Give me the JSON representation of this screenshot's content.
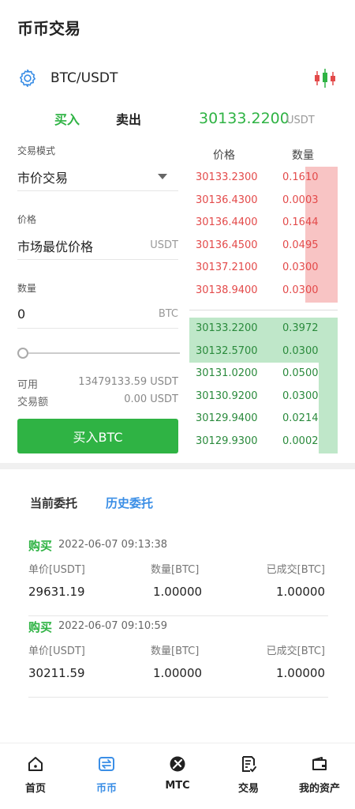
{
  "page": {
    "title": "币币交易"
  },
  "pair": {
    "symbol": "BTC/USDT"
  },
  "trade_tabs": {
    "buy": "买入",
    "sell": "卖出"
  },
  "ticker": {
    "price": "30133.2200",
    "unit": "USDT"
  },
  "form": {
    "mode_label": "交易模式",
    "mode_value": "市价交易",
    "price_label": "价格",
    "price_value": "市场最优价格",
    "price_unit": "USDT",
    "qty_label": "数量",
    "qty_value": "0",
    "qty_unit": "BTC",
    "slider_fraction": 0,
    "available_label": "可用",
    "available_value": "13479133.59 USDT",
    "amount_label": "交易额",
    "amount_value": "0.00 USDT",
    "buy_button": "买入BTC"
  },
  "book": {
    "price_header": "价格",
    "qty_header": "数量",
    "asks": [
      {
        "price": "30133.2300",
        "qty": "0.1610",
        "depth": 0.22
      },
      {
        "price": "30136.4300",
        "qty": "0.0003",
        "depth": 0.22
      },
      {
        "price": "30136.4400",
        "qty": "0.1644",
        "depth": 0.22
      },
      {
        "price": "30136.4500",
        "qty": "0.0495",
        "depth": 0.22
      },
      {
        "price": "30137.2100",
        "qty": "0.0300",
        "depth": 0.22
      },
      {
        "price": "30138.9400",
        "qty": "0.0300",
        "depth": 0.22
      }
    ],
    "bids": [
      {
        "price": "30133.2200",
        "qty": "0.3972",
        "depth": 1.0
      },
      {
        "price": "30132.5700",
        "qty": "0.0300",
        "depth": 1.0
      },
      {
        "price": "30131.0200",
        "qty": "0.0500",
        "depth": 0.13
      },
      {
        "price": "30130.9200",
        "qty": "0.0300",
        "depth": 0.13
      },
      {
        "price": "30129.9400",
        "qty": "0.0214",
        "depth": 0.13
      },
      {
        "price": "30129.9300",
        "qty": "0.0002",
        "depth": 0.13
      }
    ],
    "ask_color": "#e34a4a",
    "bid_color": "#2a8a3c"
  },
  "orders_tabs": {
    "current": "当前委托",
    "history": "历史委托"
  },
  "orders": [
    {
      "side": "购买",
      "time": "2022-06-07 09:13:38",
      "h_price": "单价[USDT]",
      "h_qty": "数量[BTC]",
      "h_filled": "已成交[BTC]",
      "price": "29631.19",
      "qty": "1.00000",
      "filled": "1.00000"
    },
    {
      "side": "购买",
      "time": "2022-06-07 09:10:59",
      "h_price": "单价[USDT]",
      "h_qty": "数量[BTC]",
      "h_filled": "已成交[BTC]",
      "price": "30211.59",
      "qty": "1.00000",
      "filled": "1.00000"
    }
  ],
  "tabbar": [
    {
      "label": "首页",
      "icon": "home-icon"
    },
    {
      "label": "币币",
      "icon": "exchange-icon",
      "active": true
    },
    {
      "label": "MTC",
      "icon": "mtc-icon"
    },
    {
      "label": "交易",
      "icon": "trade-doc-icon"
    },
    {
      "label": "我的资产",
      "icon": "wallet-icon"
    }
  ],
  "colors": {
    "green": "#2fb344",
    "blue": "#3a8ee6",
    "red": "#e34a4a"
  }
}
